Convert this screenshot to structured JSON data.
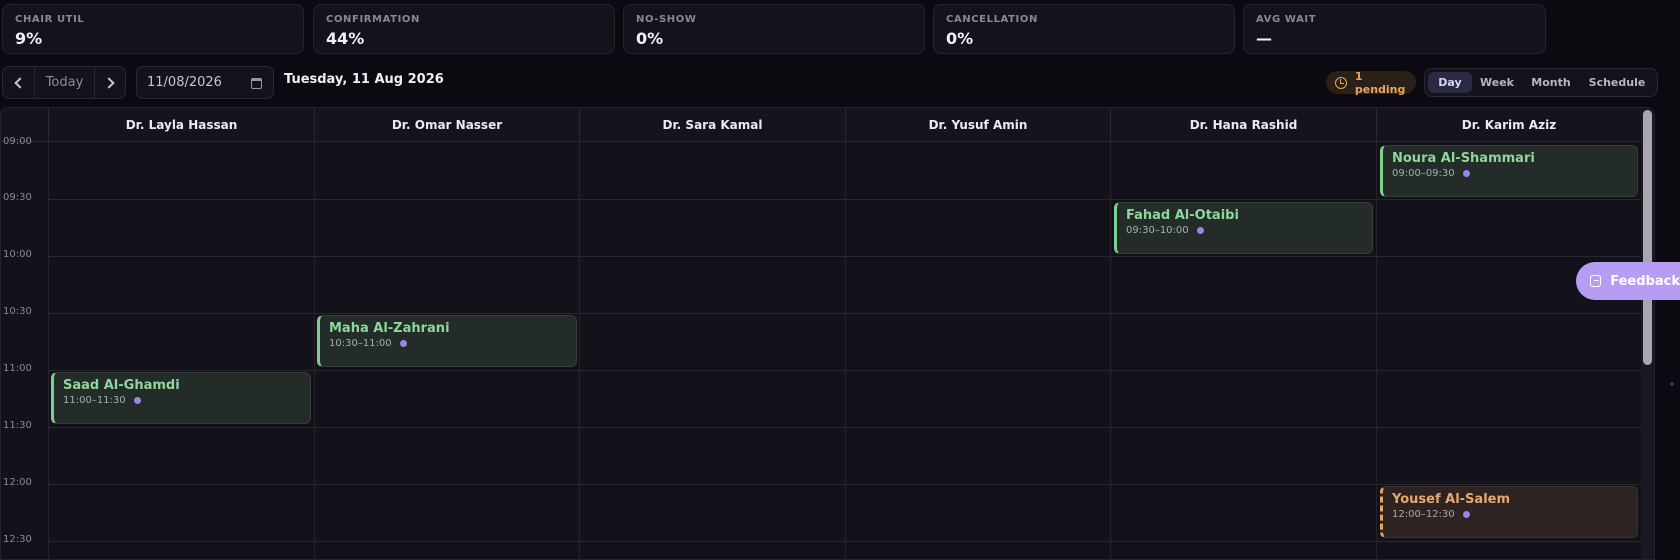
{
  "stats": [
    {
      "label": "CHAIR UTIL",
      "value": "9%"
    },
    {
      "label": "CONFIRMATION",
      "value": "44%"
    },
    {
      "label": "NO-SHOW",
      "value": "0%"
    },
    {
      "label": "CANCELLATION",
      "value": "0%"
    },
    {
      "label": "AVG WAIT",
      "value": "—"
    }
  ],
  "toolbar": {
    "today_label": "Today",
    "date_value": "11/08/2026",
    "date_title": "Tuesday, 11 Aug 2026",
    "pending_label": "1 pending",
    "views": [
      "Day",
      "Week",
      "Month",
      "Schedule"
    ],
    "active_view": "Day"
  },
  "doctors": [
    "Dr. Layla Hassan",
    "Dr. Omar Nasser",
    "Dr. Sara Kamal",
    "Dr. Yusuf Amin",
    "Dr. Hana Rashid",
    "Dr. Karim Aziz"
  ],
  "time_slots": [
    "09:00",
    "09:30",
    "10:00",
    "10:30",
    "11:00",
    "11:30",
    "12:00",
    "12:30"
  ],
  "appointments": [
    {
      "patient": "Noura Al-Shammari",
      "time": "09:00–09:30",
      "status": "confirmed"
    },
    {
      "patient": "Fahad Al-Otaibi",
      "time": "09:30–10:00",
      "status": "confirmed"
    },
    {
      "patient": "Maha Al-Zahrani",
      "time": "10:30–11:00",
      "status": "confirmed"
    },
    {
      "patient": "Saad Al-Ghamdi",
      "time": "11:00–11:30",
      "status": "confirmed"
    },
    {
      "patient": "Yousef Al-Salem",
      "time": "12:00–12:30",
      "status": "pending"
    }
  ],
  "feedback_label": "Feedback",
  "colors": {
    "accent": "#b79cf4",
    "confirmed": "#7fd08e",
    "pending": "#e8a560",
    "dot": "#9a86e6"
  }
}
